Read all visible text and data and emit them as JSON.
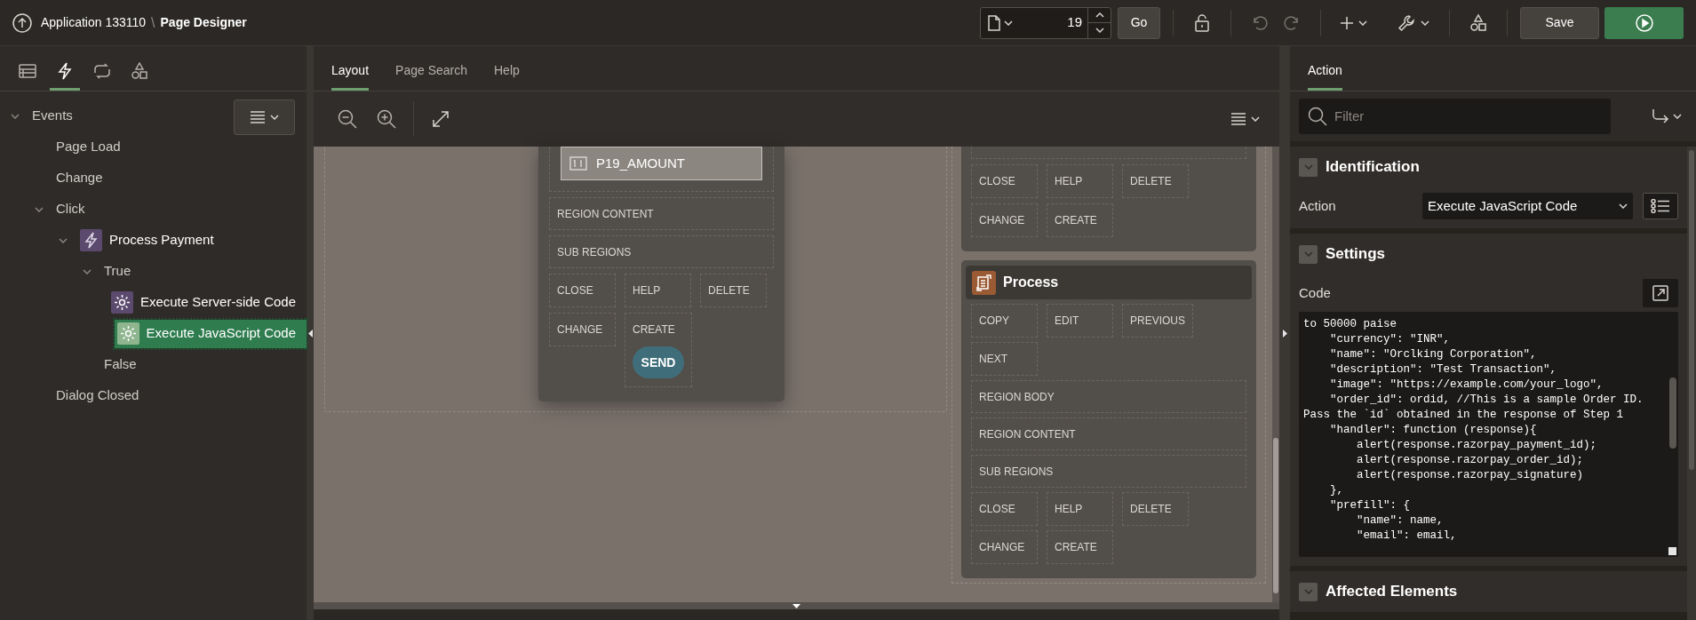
{
  "header": {
    "app": "Application 133110",
    "separator": "\\",
    "title": "Page Designer",
    "page_number": "19",
    "go": "Go",
    "save": "Save"
  },
  "left_tabs": [
    {
      "kind": "rendering",
      "selected": false
    },
    {
      "kind": "dynamic_actions",
      "selected": true
    },
    {
      "kind": "processing",
      "selected": false
    },
    {
      "kind": "shared",
      "selected": false
    }
  ],
  "tree": [
    {
      "label": "Events",
      "kind": "node",
      "selected": false,
      "expanded": true,
      "children": [
        {
          "label": "Page Load",
          "kind": "node",
          "selected": false
        },
        {
          "label": "Change",
          "kind": "node",
          "selected": false
        },
        {
          "label": "Click",
          "kind": "node",
          "selected": false,
          "expanded": true,
          "children": [
            {
              "label": "Process Payment",
              "kind": "dynamic_action",
              "selected": false,
              "expanded": true,
              "children": [
                {
                  "label": "True",
                  "kind": "node",
                  "selected": false,
                  "expanded": true,
                  "children": [
                    {
                      "label": "Execute Server-side Code",
                      "kind": "action",
                      "selected": false
                    },
                    {
                      "label": "Execute JavaScript Code",
                      "kind": "action",
                      "selected": true
                    }
                  ]
                },
                {
                  "label": "False",
                  "kind": "node",
                  "selected": false
                }
              ]
            }
          ]
        },
        {
          "label": "Dialog Closed",
          "kind": "node",
          "selected": false
        }
      ]
    }
  ],
  "center_tabs": [
    {
      "label": "Layout",
      "selected": true
    },
    {
      "label": "Page Search",
      "selected": false
    },
    {
      "label": "Help",
      "selected": false
    }
  ],
  "main_card": {
    "item": "P19_AMOUNT",
    "rows": [
      {
        "kind": "wide",
        "slots": [
          {
            "label": "REGION CONTENT"
          }
        ]
      },
      {
        "kind": "wide",
        "slots": [
          {
            "label": "SUB REGIONS"
          }
        ]
      },
      {
        "kind": "cells",
        "slots": [
          {
            "label": "CLOSE"
          },
          {
            "label": "HELP"
          },
          {
            "label": "DELETE"
          }
        ]
      },
      {
        "kind": "cells",
        "slots": [
          {
            "label": "CHANGE"
          },
          {
            "label": "CREATE",
            "button": "SEND"
          }
        ]
      }
    ]
  },
  "upper_card": {
    "rows": [
      {
        "kind": "cells",
        "slots": [
          {
            "label": "CLOSE"
          },
          {
            "label": "HELP"
          },
          {
            "label": "DELETE"
          }
        ]
      },
      {
        "kind": "cells",
        "slots": [
          {
            "label": "CHANGE"
          },
          {
            "label": "CREATE"
          }
        ]
      }
    ]
  },
  "process_card": {
    "title": "Process",
    "rows": [
      {
        "kind": "cells",
        "slots": [
          {
            "label": "COPY"
          },
          {
            "label": "EDIT"
          },
          {
            "label": "PREVIOUS"
          }
        ]
      },
      {
        "kind": "cells",
        "slots": [
          {
            "label": "NEXT"
          }
        ]
      },
      {
        "kind": "wide",
        "slots": [
          {
            "label": "REGION BODY"
          }
        ]
      },
      {
        "kind": "wide",
        "slots": [
          {
            "label": "REGION CONTENT"
          }
        ]
      },
      {
        "kind": "wide",
        "slots": [
          {
            "label": "SUB REGIONS"
          }
        ]
      },
      {
        "kind": "cells",
        "slots": [
          {
            "label": "CLOSE"
          },
          {
            "label": "HELP"
          },
          {
            "label": "DELETE"
          }
        ]
      },
      {
        "kind": "cells",
        "slots": [
          {
            "label": "CHANGE"
          },
          {
            "label": "CREATE"
          }
        ]
      }
    ]
  },
  "right_tabs": [
    {
      "label": "Action",
      "selected": true
    }
  ],
  "filter": {
    "placeholder": "Filter"
  },
  "sections": [
    {
      "title": "Identification",
      "expanded": true,
      "fields": [
        {
          "kind": "select",
          "label": "Action",
          "value": "Execute JavaScript Code"
        }
      ]
    },
    {
      "title": "Settings",
      "expanded": true,
      "fields": [
        {
          "kind": "code",
          "label": "Code",
          "lines": [
            "to 50000 paise",
            "    \"currency\": \"INR\",",
            "    \"name\": \"Orclking Corporation\",",
            "    \"description\": \"Test Transaction\",",
            "    \"image\": \"https://example.com/your_logo\",",
            "    \"order_id\": ordid, //This is a sample Order ID.",
            "Pass the `id` obtained in the response of Step 1",
            "    \"handler\": function (response){",
            "        alert(response.razorpay_payment_id);",
            "        alert(response.razorpay_order_id);",
            "        alert(response.razorpay_signature)",
            "    },",
            "    \"prefill\": {",
            "        \"name\": name,",
            "        \"email\": email,"
          ]
        }
      ]
    },
    {
      "title": "Affected Elements",
      "expanded": true
    }
  ]
}
